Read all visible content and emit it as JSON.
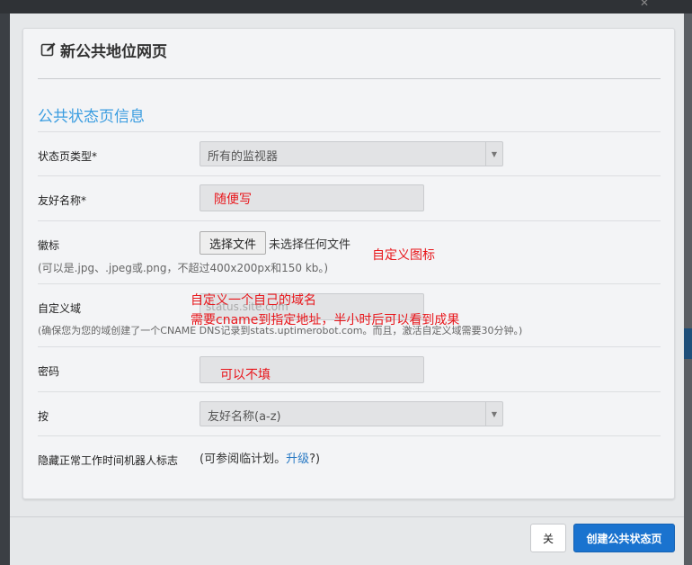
{
  "background": {
    "close_glyph": "✕"
  },
  "modal": {
    "title": "新公共地位网页",
    "title_icon": "edit-icon",
    "section_title": "公共状态页信息",
    "fields": {
      "type": {
        "label": "状态页类型*",
        "value": "所有的监视器"
      },
      "friendly_name": {
        "label": "友好名称*",
        "value": "",
        "annotation": "随便写"
      },
      "logo": {
        "label": "徽标",
        "button_label": "选择文件",
        "file_status": "未选择任何文件",
        "help": "(可以是.jpg、.jpeg或.png，不超过400x200px和150 kb。)",
        "annotation": "自定义图标"
      },
      "custom_domain": {
        "label": "自定义域",
        "placeholder": "status.site.com",
        "help": "(确保您为您的域创建了一个CNAME DNS记录到stats.uptimerobot.com。而且，激活自定义域需要30分钟。)",
        "annotation_line1": "自定义一个自己的域名",
        "annotation_line2": "需要cname到指定地址，半小时后可以看到成果"
      },
      "password": {
        "label": "密码",
        "value": "",
        "annotation": "可以不填"
      },
      "sort": {
        "label": "按",
        "value": "友好名称(a-z)"
      },
      "hide_uptime": {
        "label": "隐藏正常工作时间机器人标志",
        "text_prefix": "(可参阅临计划。",
        "link": "升级",
        "text_suffix": "?)"
      }
    },
    "footer": {
      "close_label": "关",
      "create_label": "创建公共状态页"
    }
  },
  "colors": {
    "accent": "#3b9de0",
    "primary_button": "#1a73cf",
    "annotation": "#e8161b",
    "link": "#2a7ac4"
  }
}
